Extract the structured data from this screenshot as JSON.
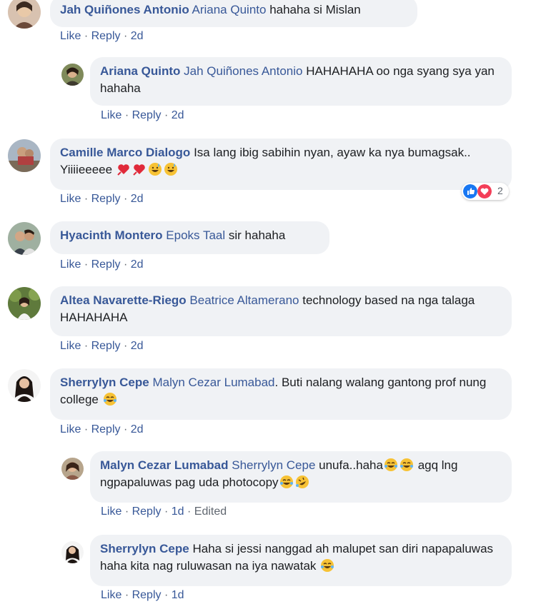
{
  "colors": {
    "link": "#385898",
    "bubble": "#f0f2f5",
    "meta": "#606770",
    "like_blue": "#1877f2",
    "love_red": "#f33e58"
  },
  "comments": [
    {
      "author": "Jah Quiñones Antonio",
      "tag": "Ariana Quinto",
      "text": "hahaha si Mislan",
      "like": "Like",
      "reply": "Reply",
      "time": "2d",
      "avatar_icon": "profile-photo"
    },
    {
      "author": "Ariana Quinto",
      "tag": "Jah Quiñones Antonio",
      "text": "HAHAHAHA oo nga syang sya yan hahaha",
      "like": "Like",
      "reply": "Reply",
      "time": "2d",
      "avatar_icon": "profile-photo"
    },
    {
      "author": "Camille Marco Dialogo",
      "tag": "",
      "text": "Isa lang ibig sabihin nyan, ayaw ka nya bumagsak.. Yiiiieeeee",
      "like": "Like",
      "reply": "Reply",
      "time": "2d",
      "reaction_count": "2",
      "avatar_icon": "profile-photo"
    },
    {
      "author": "Hyacinth Montero",
      "tag": "Epoks Taal",
      "text": "sir hahaha",
      "like": "Like",
      "reply": "Reply",
      "time": "2d",
      "avatar_icon": "profile-photo"
    },
    {
      "author": "Altea Navarette-Riego",
      "tag": "Beatrice Altamerano",
      "text": "technology based na nga talaga HAHAHAHA",
      "like": "Like",
      "reply": "Reply",
      "time": "2d",
      "avatar_icon": "profile-photo"
    },
    {
      "author": "Sherrylyn Cepe",
      "tag": "Malyn Cezar Lumabad",
      "text": ". Buti nalang walang gantong prof nung college",
      "like": "Like",
      "reply": "Reply",
      "time": "2d",
      "avatar_icon": "profile-photo"
    },
    {
      "author": "Malyn Cezar Lumabad",
      "tag": "Sherrylyn Cepe",
      "text1": "unufa..haha",
      "text2": "agq lng ngpapaluwas pag uda photocopy",
      "like": "Like",
      "reply": "Reply",
      "time": "1d",
      "edited": "Edited",
      "avatar_icon": "profile-photo"
    },
    {
      "author": "Sherrylyn Cepe",
      "tag": "",
      "text": "Haha si jessi nanggad ah malupet san diri napapaluwas haha kita nag ruluwasan na iya nawatak",
      "like": "Like",
      "reply": "Reply",
      "time": "1d",
      "avatar_icon": "profile-photo"
    }
  ]
}
